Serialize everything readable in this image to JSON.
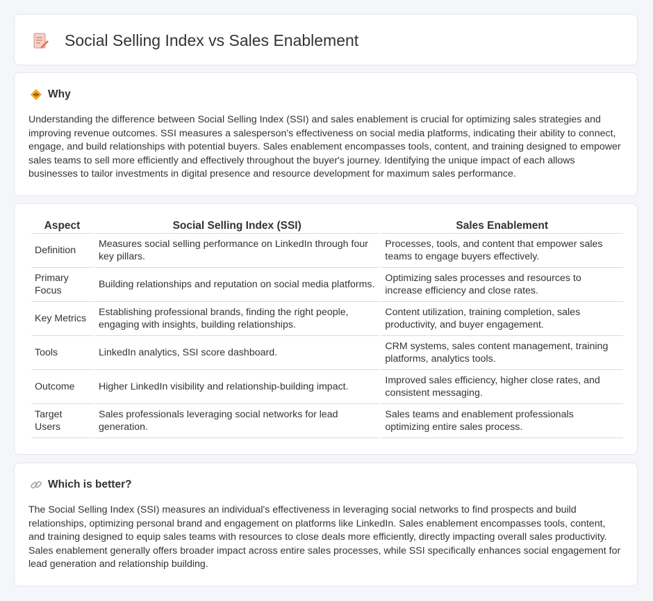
{
  "header": {
    "title": "Social Selling Index vs Sales Enablement",
    "icon": "document-edit-icon"
  },
  "why": {
    "title": "Why",
    "icon": "diamond-warning-icon",
    "body": "Understanding the difference between Social Selling Index (SSI) and sales enablement is crucial for optimizing sales strategies and improving revenue outcomes. SSI measures a salesperson's effectiveness on social media platforms, indicating their ability to connect, engage, and build relationships with potential buyers. Sales enablement encompasses tools, content, and training designed to empower sales teams to sell more efficiently and effectively throughout the buyer's journey. Identifying the unique impact of each allows businesses to tailor investments in digital presence and resource development for maximum sales performance."
  },
  "comparison": {
    "headers": [
      "Aspect",
      "Social Selling Index (SSI)",
      "Sales Enablement"
    ],
    "rows": [
      {
        "aspect": "Definition",
        "ssi": "Measures social selling performance on LinkedIn through four key pillars.",
        "se": "Processes, tools, and content that empower sales teams to engage buyers effectively."
      },
      {
        "aspect": "Primary Focus",
        "ssi": "Building relationships and reputation on social media platforms.",
        "se": "Optimizing sales processes and resources to increase efficiency and close rates."
      },
      {
        "aspect": "Key Metrics",
        "ssi": "Establishing professional brands, finding the right people, engaging with insights, building relationships.",
        "se": "Content utilization, training completion, sales productivity, and buyer engagement."
      },
      {
        "aspect": "Tools",
        "ssi": "LinkedIn analytics, SSI score dashboard.",
        "se": "CRM systems, sales content management, training platforms, analytics tools."
      },
      {
        "aspect": "Outcome",
        "ssi": "Higher LinkedIn visibility and relationship-building impact.",
        "se": "Improved sales efficiency, higher close rates, and consistent messaging."
      },
      {
        "aspect": "Target Users",
        "ssi": "Sales professionals leveraging social networks for lead generation.",
        "se": "Sales teams and enablement professionals optimizing entire sales process."
      }
    ]
  },
  "better": {
    "title": "Which is better?",
    "icon": "link-icon",
    "body": "The Social Selling Index (SSI) measures an individual's effectiveness in leveraging social networks to find prospects and build relationships, optimizing personal brand and engagement on platforms like LinkedIn. Sales enablement encompasses tools, content, and training designed to equip sales teams with resources to close deals more efficiently, directly impacting overall sales productivity. Sales enablement generally offers broader impact across entire sales processes, while SSI specifically enhances social engagement for lead generation and relationship building."
  }
}
